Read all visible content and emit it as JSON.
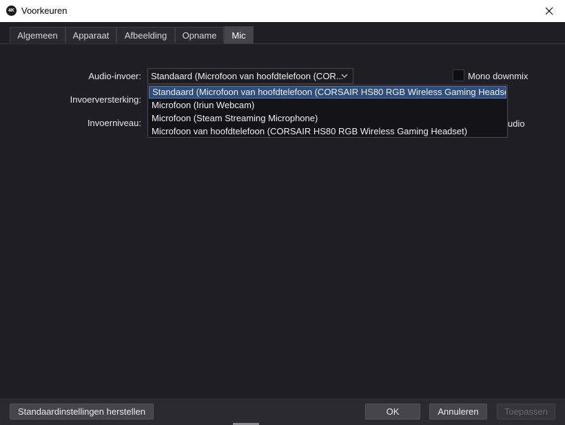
{
  "window": {
    "title": "Voorkeuren",
    "app_icon_text": "4K",
    "close_icon": "close-icon"
  },
  "tabs": [
    {
      "label": "Algemeen",
      "active": false
    },
    {
      "label": "Apparaat",
      "active": false
    },
    {
      "label": "Afbeelding",
      "active": false
    },
    {
      "label": "Opname",
      "active": false
    },
    {
      "label": "Mic",
      "active": true
    }
  ],
  "mic": {
    "audio_input_label": "Audio-invoer:",
    "audio_input_value": "Standaard (Microfoon van hoofdtelefoon (CORSAIR HS80 RGB Wireless Gaming Headset))",
    "audio_input_display": "Standaard (Microfoon van hoofdtelefoon (COR...",
    "gain_label": "Invoerversterking:",
    "level_label": "Invoerniveau:",
    "mono_downmix_label": "Mono downmix",
    "mono_downmix_checked": false,
    "partial_text": "udio",
    "dropdown_options": [
      "Standaard (Microfoon van hoofdtelefoon (CORSAIR HS80 RGB Wireless Gaming Headset))",
      "Microfoon (Iriun Webcam)",
      "Microfoon (Steam Streaming Microphone)",
      "Microfoon van hoofdtelefoon (CORSAIR HS80 RGB Wireless Gaming Headset)"
    ],
    "selected_index": 0
  },
  "footer": {
    "reset_label": "Standaardinstellingen herstellen",
    "ok_label": "OK",
    "cancel_label": "Annuleren",
    "apply_label": "Toepassen"
  },
  "colors": {
    "background": "#1f1e25",
    "selection": "#2f4d7a",
    "button": "#45444c"
  }
}
